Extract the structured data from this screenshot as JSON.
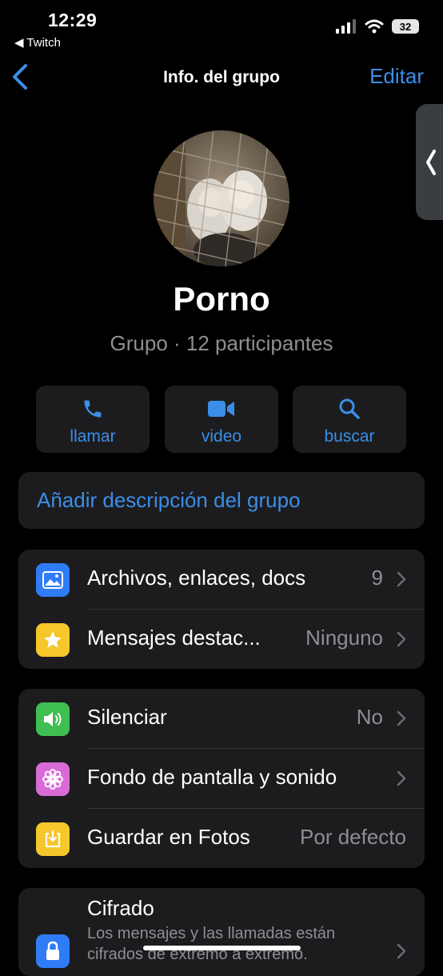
{
  "status_bar": {
    "time": "12:29",
    "back_app": "◀ Twitch",
    "battery": "32"
  },
  "nav": {
    "title": "Info. del grupo",
    "edit": "Editar"
  },
  "group": {
    "name": "Porno",
    "subtitle": "Grupo · 12 participantes"
  },
  "actions": [
    {
      "label": "llamar",
      "icon": "phone-icon"
    },
    {
      "label": "video",
      "icon": "video-icon"
    },
    {
      "label": "buscar",
      "icon": "search-icon"
    }
  ],
  "description": {
    "label": "Añadir descripción del grupo"
  },
  "section1": [
    {
      "label": "Archivos, enlaces, docs",
      "value": "9",
      "icon": "photo-icon",
      "color": "#2f7cf6"
    },
    {
      "label": "Mensajes destac...",
      "value": "Ninguno",
      "icon": "star-icon",
      "color": "#f5c72a"
    }
  ],
  "section2": [
    {
      "label": "Silenciar",
      "value": "No",
      "icon": "speaker-icon",
      "color": "#3fbf52"
    },
    {
      "label": "Fondo de pantalla y sonido",
      "value": "",
      "icon": "flower-icon",
      "color": "#d96bd6"
    },
    {
      "label": "Guardar en Fotos",
      "value": "Por defecto",
      "icon": "save-icon",
      "color": "#f5c72a"
    }
  ],
  "section3": [
    {
      "label": "Cifrado",
      "detail_1": "Los mensajes y las llamadas están",
      "detail_2": "cifrados de extremo a extremo.",
      "icon": "lock-icon",
      "color": "#2f7cf6"
    }
  ],
  "colors": {
    "accent": "#3b8ee8",
    "card": "#1c1c1e",
    "secondary_text": "#8e8e93"
  }
}
